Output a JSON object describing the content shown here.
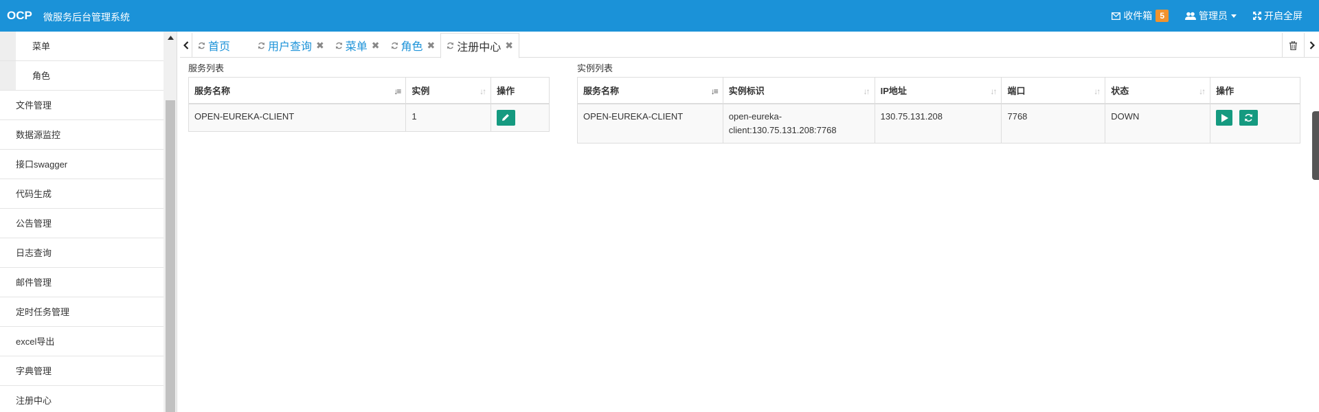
{
  "header": {
    "logo": "OCP",
    "system_title": "微服务后台管理系统",
    "inbox_label": "收件箱",
    "inbox_count": "5",
    "user_label": "管理员",
    "fullscreen_label": "开启全屏"
  },
  "sidebar": {
    "sub_items": [
      {
        "label": "菜单"
      },
      {
        "label": "角色"
      }
    ],
    "items": [
      {
        "label": "文件管理"
      },
      {
        "label": "数据源监控"
      },
      {
        "label": "接口swagger"
      },
      {
        "label": "代码生成"
      },
      {
        "label": "公告管理"
      },
      {
        "label": "日志查询"
      },
      {
        "label": "邮件管理"
      },
      {
        "label": "定时任务管理"
      },
      {
        "label": "excel导出"
      },
      {
        "label": "字典管理"
      },
      {
        "label": "注册中心"
      }
    ]
  },
  "tabs": [
    {
      "label": "首页",
      "closable": false
    },
    {
      "label": "用户查询",
      "closable": true
    },
    {
      "label": "菜单",
      "closable": true
    },
    {
      "label": "角色",
      "closable": true
    },
    {
      "label": "注册中心",
      "closable": true,
      "active": true
    }
  ],
  "services": {
    "title": "服务列表",
    "headers": [
      "服务名称",
      "实例",
      "操作"
    ],
    "rows": [
      {
        "name": "OPEN-EUREKA-CLIENT",
        "instances": "1"
      }
    ]
  },
  "instances": {
    "title": "实例列表",
    "headers": [
      "服务名称",
      "实例标识",
      "IP地址",
      "端口",
      "状态",
      "操作"
    ],
    "rows": [
      {
        "service": "OPEN-EUREKA-CLIENT",
        "id_line1": "open-eureka-",
        "id_line2": "client:130.75.131.208:7768",
        "ip": "130.75.131.208",
        "port": "7768",
        "status": "DOWN"
      }
    ]
  },
  "colors": {
    "header_bg": "#1b92d8",
    "badge": "#f0932e",
    "action_button": "#159a80"
  }
}
